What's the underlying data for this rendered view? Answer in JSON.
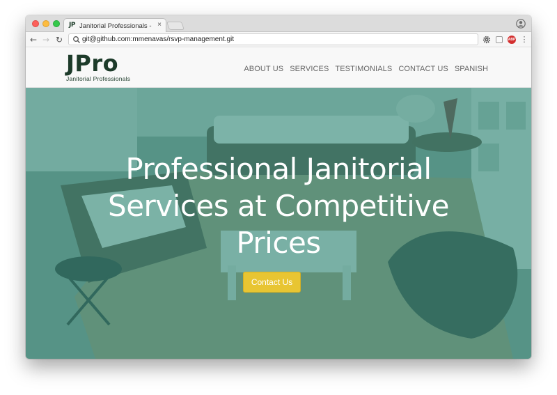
{
  "browser": {
    "tab_favicon": "JP",
    "tab_title": "Janitorial Professionals - Commercial",
    "tab_close": "×",
    "address": "git@github.com:mmenavas/rsvp-management.git",
    "nav_back": "←",
    "nav_forward": "→",
    "nav_reload": "↻",
    "ext_abp": "ABP",
    "menu": "⋮"
  },
  "site": {
    "logo": "JPro",
    "logo_subtitle": "Janitorial Professionals",
    "nav": [
      "ABOUT US",
      "SERVICES",
      "TESTIMONIALS",
      "CONTACT US",
      "SPANISH"
    ]
  },
  "hero": {
    "title": "Professional Janitorial Services at Competitive Prices",
    "cta": "Contact Us"
  },
  "colors": {
    "brand_dark": "#1d3b2a",
    "hero_overlay": "#348c7d",
    "cta": "#e8c532"
  },
  "icons": [
    "search-icon",
    "gear-icon",
    "extension-icon",
    "adblock-icon",
    "profile-icon",
    "menu-icon"
  ]
}
